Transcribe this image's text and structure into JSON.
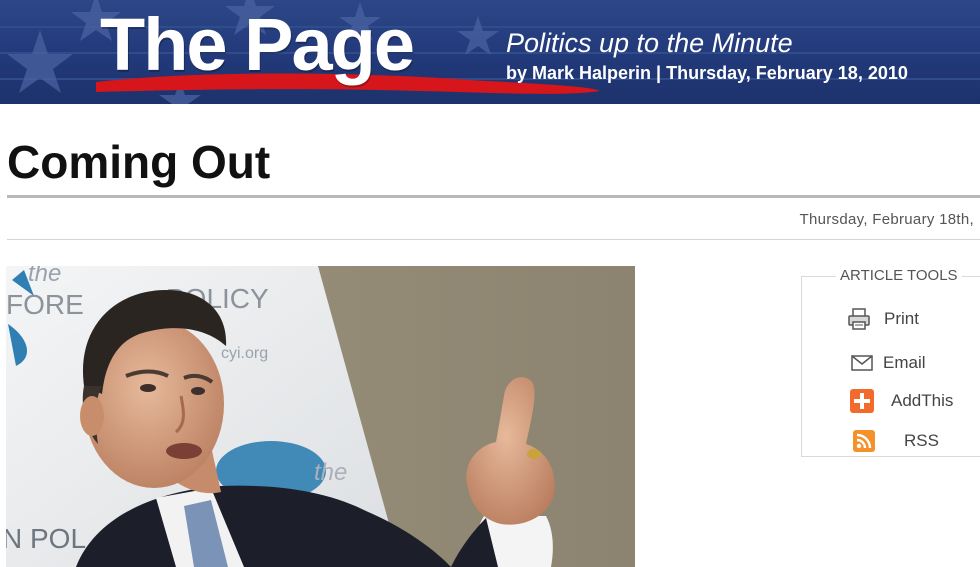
{
  "banner": {
    "logo_text": "The Page",
    "tagline": "Politics up to the Minute",
    "byline": "by Mark Halperin | Thursday, February 18, 2010",
    "colors": {
      "background": "#22397a",
      "swoosh": "#d7161b",
      "text": "#ffffff"
    }
  },
  "article": {
    "headline": "Coming Out",
    "dateline": "Thursday, February 18th,"
  },
  "photo": {
    "backdrop_text_1": "the",
    "backdrop_text_2": "FORE",
    "backdrop_text_3": "POLICY",
    "backdrop_text_4": "cyi.org",
    "backdrop_text_5": "the",
    "backdrop_text_6": "N POL"
  },
  "article_tools": {
    "title": "ARTICLE TOOLS",
    "items": [
      {
        "label": "Print",
        "icon": "printer-icon"
      },
      {
        "label": "Email",
        "icon": "envelope-icon"
      },
      {
        "label": "AddThis",
        "icon": "plus-icon",
        "color": "#f26b2c"
      },
      {
        "label": "RSS",
        "icon": "rss-icon",
        "color": "#f5912a"
      }
    ]
  }
}
